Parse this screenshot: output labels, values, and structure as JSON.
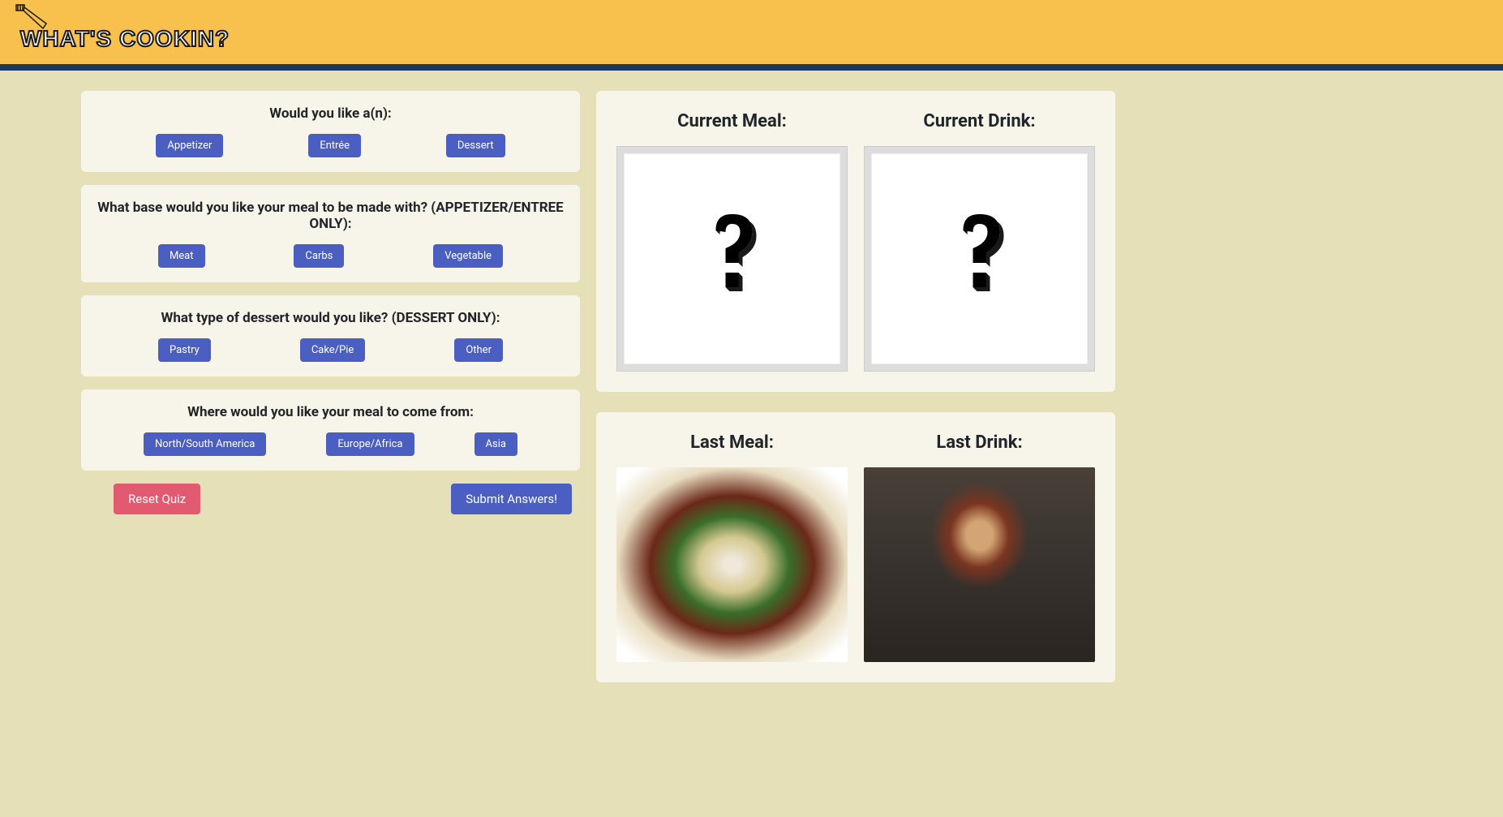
{
  "header": {
    "title": "WHAT'S COOKIN?"
  },
  "questions": {
    "q1": {
      "text": "Would you like a(n):",
      "options": [
        "Appetizer",
        "Entrée",
        "Dessert"
      ]
    },
    "q2": {
      "text": "What base would you like your meal to be made with? (APPETIZER/ENTREE ONLY):",
      "options": [
        "Meat",
        "Carbs",
        "Vegetable"
      ]
    },
    "q3": {
      "text": "What type of dessert would you like? (DESSERT ONLY):",
      "options": [
        "Pastry",
        "Cake/Pie",
        "Other"
      ]
    },
    "q4": {
      "text": "Where would you like your meal to come from:",
      "options": [
        "North/South America",
        "Europe/Africa",
        "Asia"
      ]
    }
  },
  "actions": {
    "reset": "Reset Quiz",
    "submit": "Submit Answers!"
  },
  "results": {
    "current_meal_title": "Current Meal:",
    "current_drink_title": "Current Drink:",
    "last_meal_title": "Last Meal:",
    "last_drink_title": "Last Drink:"
  },
  "colors": {
    "header_bg": "#f8c04c",
    "header_border": "#1a3a5c",
    "body_bg": "#e5e0b8",
    "card_bg": "#f7f4ea",
    "button_primary": "#4a5fc1",
    "button_danger": "#e15a6f"
  }
}
